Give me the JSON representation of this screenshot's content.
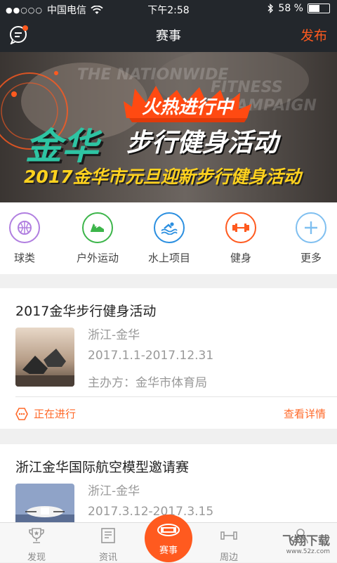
{
  "status_bar": {
    "signal": "●●○○○",
    "carrier": "中国电信",
    "time": "下午2:58",
    "battery_percent": "58 %",
    "battery_level": 0.58
  },
  "navbar": {
    "title": "赛事",
    "publish_label": "发布"
  },
  "banner": {
    "bg_text_1": "THE NATIONWIDE",
    "bg_text_2": "FITNESS",
    "bg_text_3": "CAMPAIGN",
    "hot_label": "火热进行中",
    "city": "金华",
    "event": "步行健身活动",
    "subtitle": "2017金华市元旦迎新步行健身活动"
  },
  "categories": [
    {
      "label": "球类",
      "icon": "basketball-icon",
      "color": "#b07ee0"
    },
    {
      "label": "户外运动",
      "icon": "shoe-icon",
      "color": "#3cb54a"
    },
    {
      "label": "水上项目",
      "icon": "swimming-icon",
      "color": "#2b8fe0"
    },
    {
      "label": "健身",
      "icon": "dumbbell-icon",
      "color": "#ff5a1f"
    },
    {
      "label": "更多",
      "icon": "plus-icon",
      "color": "#7fbff0"
    }
  ],
  "events": [
    {
      "title": "2017金华步行健身活动",
      "location": "浙江-金华",
      "dates": "2017.1.1-2017.12.31",
      "organizer": "主办方：金华市体育局",
      "status": "正在进行",
      "detail_label": "查看详情"
    },
    {
      "title": "浙江金华国际航空模型邀请赛",
      "location": "浙江-金华",
      "dates": "2017.3.12-2017.3.15"
    }
  ],
  "tabbar": {
    "items": [
      {
        "label": "发现",
        "icon": "trophy-icon"
      },
      {
        "label": "资讯",
        "icon": "news-icon"
      },
      {
        "label": "赛事",
        "icon": "stadium-icon"
      },
      {
        "label": "周边",
        "icon": "dumbbell-icon"
      }
    ]
  },
  "watermark": {
    "text": "飞翔下载",
    "domain": "www.52z.com"
  },
  "colors": {
    "accent": "#ff5a1f",
    "navbar_bg": "#23272c"
  }
}
